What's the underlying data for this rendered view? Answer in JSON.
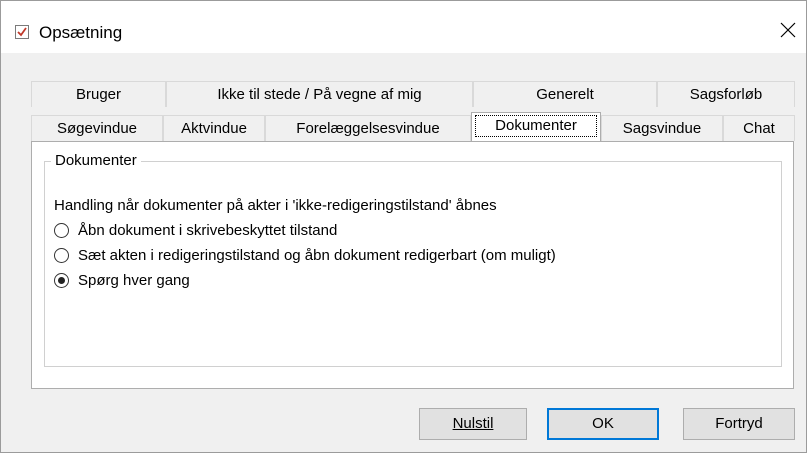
{
  "window": {
    "title": "Opsætning"
  },
  "icons": {
    "app": "form-check-icon",
    "close": "close-icon"
  },
  "tabs": {
    "row_back": [
      "Bruger",
      "Ikke til stede / På vegne af mig",
      "Generelt",
      "Sagsforløb"
    ],
    "row_front": [
      "Søgevindue",
      "Aktvindue",
      "Forelæggelsesvindue",
      "Dokumenter",
      "Sagsvindue",
      "Chat"
    ],
    "selected": "Dokumenter"
  },
  "group": {
    "label": "Dokumenter",
    "question": "Handling når dokumenter på akter i 'ikke-redigeringstilstand' åbnes",
    "options": [
      {
        "label": "Åbn dokument i skrivebeskyttet tilstand",
        "checked": false
      },
      {
        "label": "Sæt akten i redigeringstilstand og åbn dokument redigerbart (om muligt)",
        "checked": false
      },
      {
        "label": "Spørg hver gang",
        "checked": true
      }
    ]
  },
  "buttons": {
    "reset": "Nulstil",
    "ok": "OK",
    "cancel": "Fortryd"
  },
  "colors": {
    "accent": "#0078d7",
    "dialog_bg": "#f0f0f0",
    "panel_bg": "#ffffff"
  }
}
